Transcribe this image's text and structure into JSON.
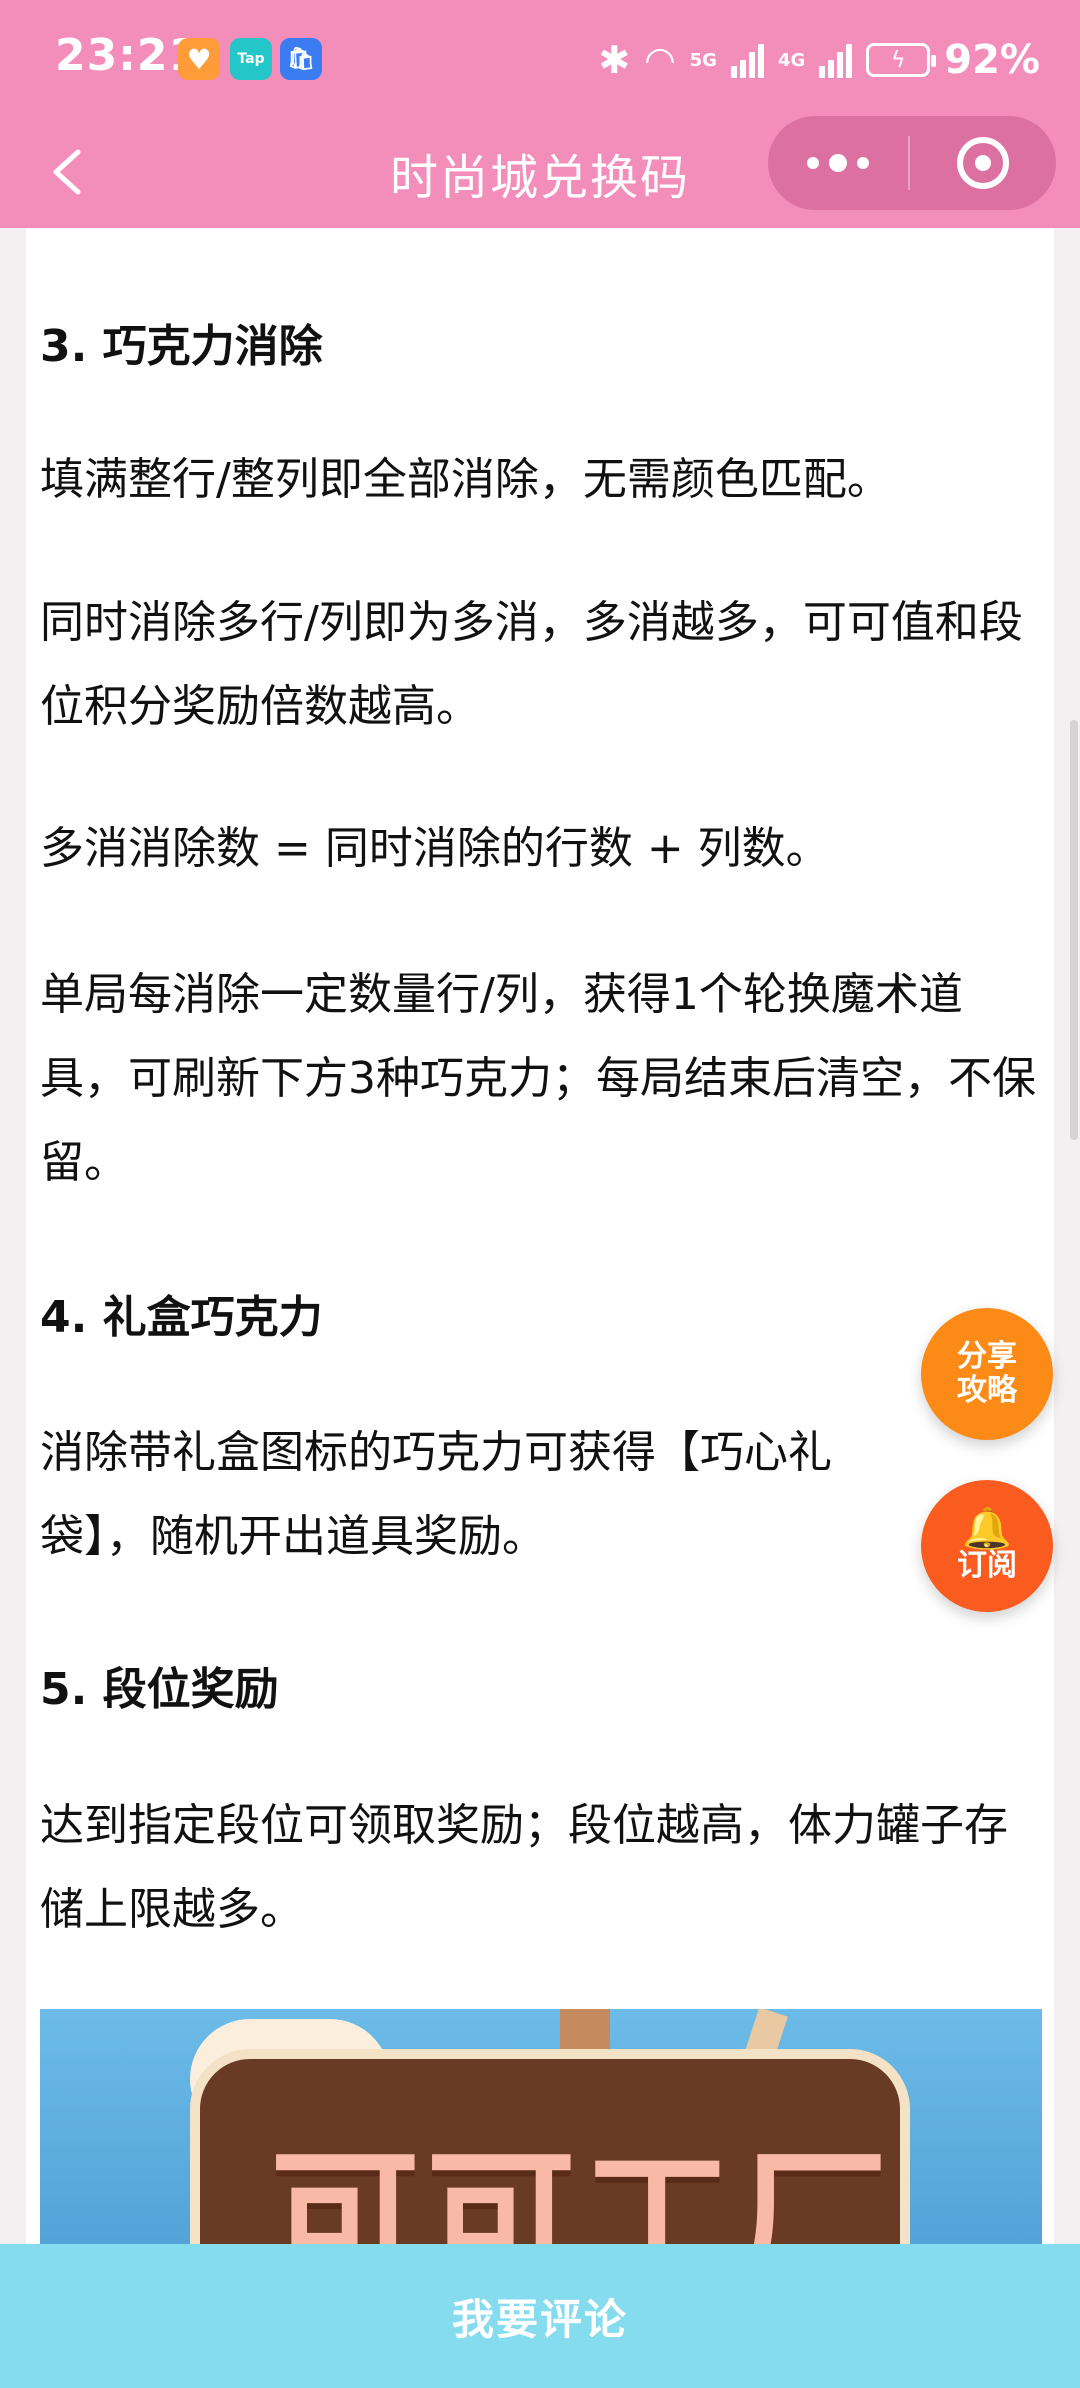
{
  "status_bar": {
    "time": "23:21",
    "network_5g": "5G",
    "network_4g": "4G",
    "battery_percent": "92%"
  },
  "nav": {
    "title": "时尚城兑换码"
  },
  "article": {
    "heading_3": "3. 巧克力消除",
    "p1": "填满整行/整列即全部消除，无需颜色匹配。",
    "p2": "同时消除多行/列即为多消，多消越多，可可值和段位积分奖励倍数越高。",
    "p3": "多消消除数 = 同时消除的行数 + 列数。",
    "p4": "单局每消除一定数量行/列，获得1个轮换魔术道具，可刷新下方3种巧克力；每局结束后清空，不保留。",
    "heading_4": "4. 礼盒巧克力",
    "p5": "消除带礼盒图标的巧克力可获得【巧心礼袋】，随机开出道具奖励。",
    "heading_5": "5. 段位奖励",
    "p6": "达到指定段位可领取奖励；段位越高，体力罐子存储上限越多。"
  },
  "banner": {
    "logo_text": "可可工厂"
  },
  "floating": {
    "share_line1": "分享",
    "share_line2": "攻略",
    "subscribe": "订阅"
  },
  "bottom": {
    "comment_label": "我要评论"
  },
  "colors": {
    "topbar": "#f38dba",
    "bottombar": "#86dcef",
    "share_button": "#fb8a17",
    "subscribe_button": "#fa5b1e"
  }
}
